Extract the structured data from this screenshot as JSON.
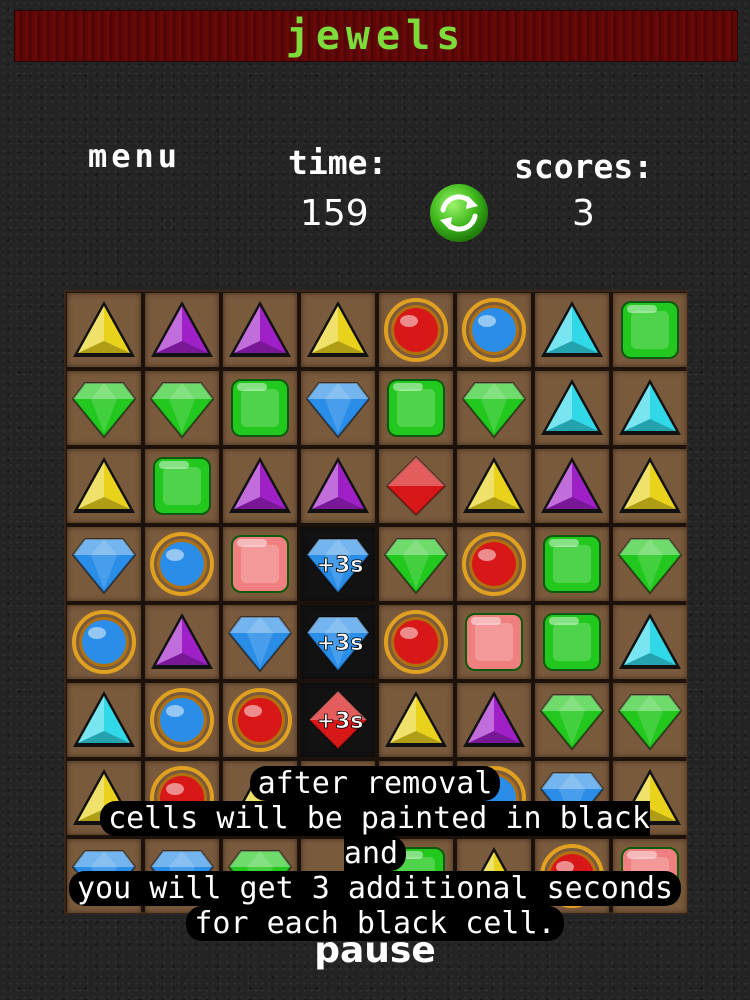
{
  "title": "jewels",
  "hud": {
    "menu_label": "menu",
    "time_label": "time:",
    "time_value": "159",
    "scores_label": "scores:",
    "scores_value": "3",
    "refresh_icon": "refresh-icon"
  },
  "board": {
    "rows": 8,
    "cols": 8,
    "grid": [
      [
        "yellow-triangle",
        "purple-triangle",
        "purple-triangle",
        "yellow-triangle",
        "red-orb",
        "blue-orb",
        "cyan-triangle",
        "green-square"
      ],
      [
        "green-gem",
        "green-gem",
        "green-square",
        "blue-gem",
        "green-square",
        "green-gem",
        "cyan-triangle",
        "cyan-triangle"
      ],
      [
        "yellow-triangle",
        "green-square",
        "purple-triangle",
        "purple-triangle",
        "red-diamond",
        "yellow-triangle",
        "purple-triangle",
        "yellow-triangle"
      ],
      [
        "blue-gem",
        "blue-orb",
        "pink-square",
        "blue-gem+3s",
        "green-gem",
        "red-orb",
        "green-square",
        "green-gem"
      ],
      [
        "blue-orb",
        "purple-triangle",
        "blue-gem",
        "blue-gem+3s",
        "red-orb",
        "pink-square",
        "green-square",
        "cyan-triangle"
      ],
      [
        "cyan-triangle",
        "blue-orb",
        "red-orb",
        "red-diamond+3s",
        "yellow-triangle",
        "purple-triangle",
        "green-gem",
        "green-gem"
      ],
      [
        "yellow-triangle",
        "red-orb",
        "yellow-triangle",
        "empty",
        "yellow-triangle",
        "blue-orb",
        "blue-gem",
        "yellow-triangle"
      ],
      [
        "blue-gem",
        "blue-gem",
        "green-gem",
        "empty",
        "green-square",
        "yellow-triangle",
        "red-orb",
        "pink-square"
      ]
    ],
    "black_cells": [
      [
        3,
        3
      ],
      [
        4,
        3
      ],
      [
        5,
        3
      ]
    ],
    "bonus_label": "+3s",
    "colors": {
      "yellow": "#e8d21c",
      "purple": "#a020c8",
      "cyan": "#30d8e8",
      "green": "#22c81e",
      "blue": "#2a8ee8",
      "red": "#d81818",
      "pink": "#f08080",
      "cell_bg": "#7a5a3c"
    }
  },
  "hint_lines": [
    "after removal",
    "cells will be painted in black and",
    "you will get 3 additional seconds",
    "for each black cell."
  ],
  "pause_label": "pause"
}
